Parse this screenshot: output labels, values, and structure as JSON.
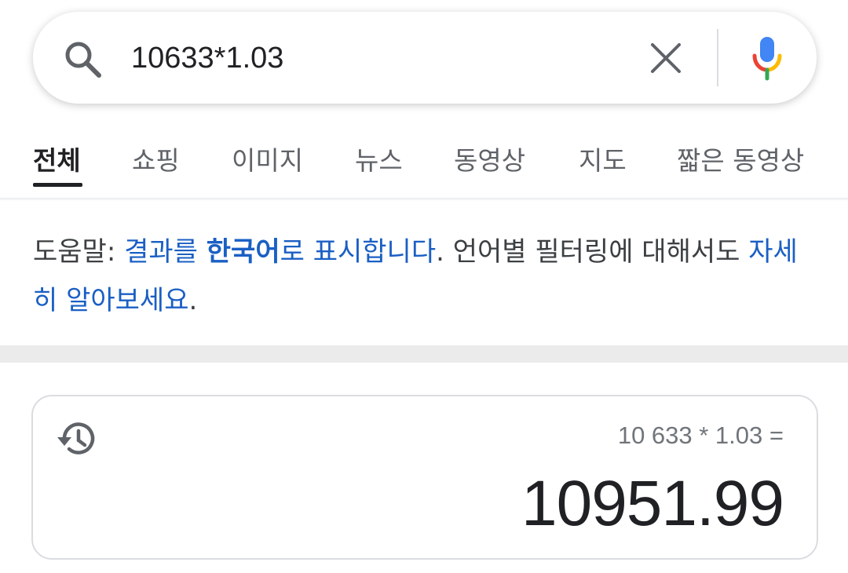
{
  "search": {
    "query": "10633*1.03"
  },
  "tabs": [
    {
      "label": "전체",
      "active": true
    },
    {
      "label": "쇼핑",
      "active": false
    },
    {
      "label": "이미지",
      "active": false
    },
    {
      "label": "뉴스",
      "active": false
    },
    {
      "label": "동영상",
      "active": false
    },
    {
      "label": "지도",
      "active": false
    },
    {
      "label": "짧은 동영상",
      "active": false
    }
  ],
  "notice": {
    "prefix": "도움말: ",
    "link1_part1": "결과를 ",
    "link1_bold": "한국어",
    "link1_part2": "로 표시합니다",
    "middle": ". 언어별 필터링에 대해서도 ",
    "link2": "자세히 알아보세요",
    "suffix": "."
  },
  "calculator": {
    "expression": "10 633 * 1.03 =",
    "result": "10951.99"
  },
  "colors": {
    "link": "#1a5fc4",
    "text": "#202124",
    "muted": "#5f6368",
    "separator": "#ebebeb",
    "mic_blue": "#4285f4",
    "mic_red": "#ea4335",
    "mic_yellow": "#fbbc05",
    "mic_green": "#34a853"
  },
  "icons": {
    "search": "search-icon",
    "clear": "close-icon",
    "mic": "microphone-icon",
    "history": "history-icon"
  }
}
